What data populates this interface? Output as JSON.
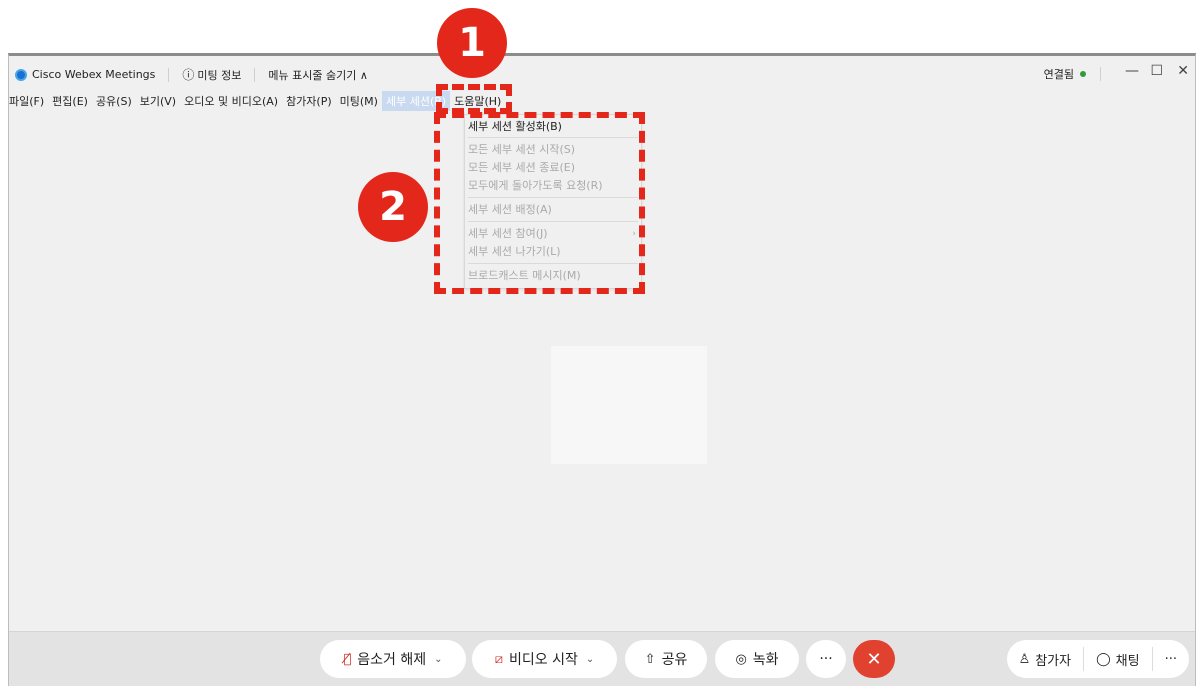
{
  "titlebar": {
    "app_name": "Cisco Webex Meetings",
    "meeting_info": "미팅 정보",
    "hide_menu": "메뉴 표시줄 숨기기 ∧",
    "connection_status": "연결됨",
    "status_color": "#2e9c3b"
  },
  "menubar": {
    "items": [
      "파일(F)",
      "편집(E)",
      "공유(S)",
      "보기(V)",
      "오디오 및 비디오(A)",
      "참가자(P)",
      "미팅(M)",
      "세부 세션(B)",
      "도움말(H)"
    ],
    "active_index": 7
  },
  "breakout_menu": {
    "items": [
      {
        "label": "세부 세션 활성화(B)",
        "enabled": true
      },
      {
        "label": "모든 세부 세션 시작(S)",
        "enabled": false
      },
      {
        "label": "모든 세부 세션 종료(E)",
        "enabled": false
      },
      {
        "label": "모두에게 돌아가도록 요청(R)",
        "enabled": false
      },
      {
        "label": "세부 세션 배정(A)",
        "enabled": false
      },
      {
        "label": "세부 세션 참여(J)",
        "enabled": false
      },
      {
        "label": "세부 세션 나가기(L)",
        "enabled": false
      },
      {
        "label": "브로드캐스트 메시지(M)",
        "enabled": false
      }
    ]
  },
  "toolbar": {
    "unmute": "음소거 해제",
    "start_video": "비디오 시작",
    "share": "공유",
    "record": "녹화",
    "more": "···",
    "participants": "참가자",
    "chat": "채팅",
    "panel_more": "···"
  },
  "annotations": {
    "badge1": "1",
    "badge2": "2",
    "color": "#e3281b"
  },
  "icons": {
    "logo": "webex-logo-icon",
    "info": "info-icon",
    "mic_muted": "mic-muted-icon",
    "video_off": "video-off-icon",
    "share": "share-icon",
    "record": "record-icon",
    "end": "close-icon",
    "participants": "person-icon",
    "chat": "chat-bubble-icon"
  }
}
